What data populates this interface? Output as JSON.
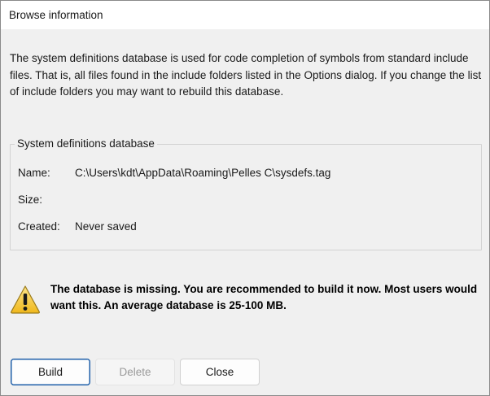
{
  "window": {
    "title": "Browse information"
  },
  "description": "The system definitions database is used for code completion of symbols from standard include files. That is, all files found in the include folders listed in the Options dialog. If you change the list of include folders you may want to rebuild this database.",
  "database_group": {
    "label": "System definitions database",
    "name_label": "Name:",
    "name_value": "C:\\Users\\kdt\\AppData\\Roaming\\Pelles C\\sysdefs.tag",
    "size_label": "Size:",
    "size_value": "",
    "created_label": "Created:",
    "created_value": "Never saved"
  },
  "warning": {
    "icon": "warning-icon",
    "text": "The database is missing. You are recommended to build it now. Most users would want this. An average database is 25-100 MB."
  },
  "buttons": {
    "build_label": "Build",
    "delete_label": "Delete",
    "close_label": "Close"
  },
  "colors": {
    "accent": "#1f5fa9",
    "warning_fill": "#f5c92a",
    "background": "#f0f0f0"
  }
}
